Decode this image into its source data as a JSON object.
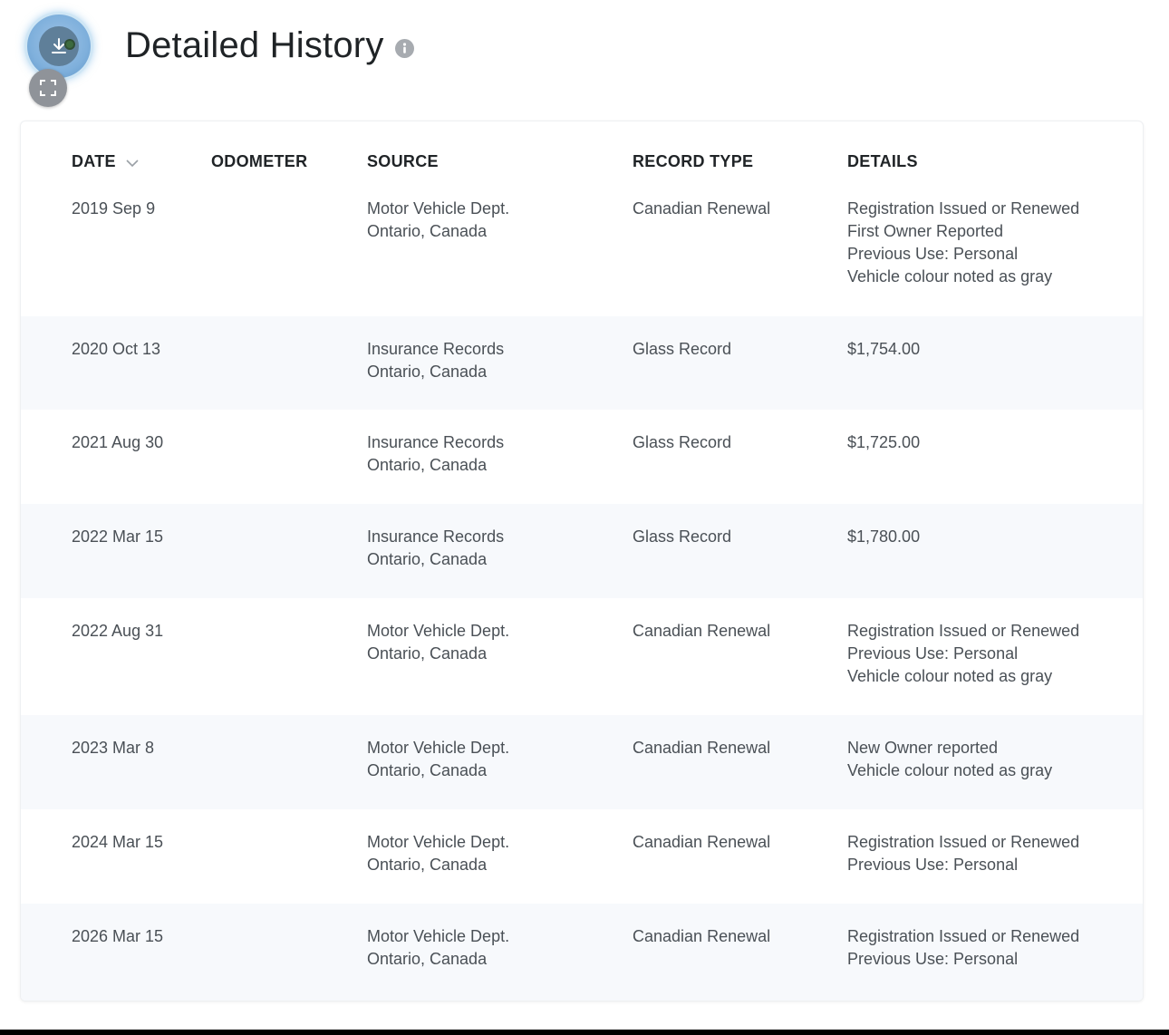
{
  "page": {
    "title": "Detailed History",
    "download_icon": "download-icon",
    "expand_icon": "fullscreen-icon",
    "info_icon": "info-icon"
  },
  "table": {
    "headers": {
      "date": "DATE",
      "odometer": "ODOMETER",
      "source": "SOURCE",
      "record_type": "RECORD TYPE",
      "details": "DETAILS"
    },
    "sort_icon": "chevron-down-icon",
    "rows": [
      {
        "date": "2019 Sep 9",
        "odometer": "",
        "source": [
          "Motor Vehicle Dept.",
          "Ontario, Canada"
        ],
        "record_type": "Canadian Renewal",
        "details": [
          "Registration Issued or Renewed",
          "First Owner Reported",
          "Previous Use: Personal",
          "Vehicle colour noted as gray"
        ]
      },
      {
        "date": "2020 Oct 13",
        "odometer": "",
        "source": [
          "Insurance Records",
          "Ontario, Canada"
        ],
        "record_type": "Glass Record",
        "details": [
          "$1,754.00"
        ]
      },
      {
        "date": "2021 Aug 30",
        "odometer": "",
        "source": [
          "Insurance Records",
          "Ontario, Canada"
        ],
        "record_type": "Glass Record",
        "details": [
          "$1,725.00"
        ]
      },
      {
        "date": "2022 Mar 15",
        "odometer": "",
        "source": [
          "Insurance Records",
          "Ontario, Canada"
        ],
        "record_type": "Glass Record",
        "details": [
          "$1,780.00"
        ]
      },
      {
        "date": "2022 Aug 31",
        "odometer": "",
        "source": [
          "Motor Vehicle Dept.",
          "Ontario, Canada"
        ],
        "record_type": "Canadian Renewal",
        "details": [
          "Registration Issued or Renewed",
          "Previous Use: Personal",
          "Vehicle colour noted as gray"
        ]
      },
      {
        "date": "2023 Mar 8",
        "odometer": "",
        "source": [
          "Motor Vehicle Dept.",
          "Ontario, Canada"
        ],
        "record_type": "Canadian Renewal",
        "details": [
          "New Owner reported",
          "Vehicle colour noted as gray"
        ]
      },
      {
        "date": "2024 Mar 15",
        "odometer": "",
        "source": [
          "Motor Vehicle Dept.",
          "Ontario, Canada"
        ],
        "record_type": "Canadian Renewal",
        "details": [
          "Registration Issued or Renewed",
          "Previous Use: Personal"
        ]
      },
      {
        "date": "2026 Mar 15",
        "odometer": "",
        "source": [
          "Motor Vehicle Dept.",
          "Ontario, Canada"
        ],
        "record_type": "Canadian Renewal",
        "details": [
          "Registration Issued or Renewed",
          "Previous Use: Personal"
        ]
      }
    ]
  },
  "colors": {
    "alt_row": "#f7f9fc",
    "text": "#4a5056",
    "heading": "#1f2326"
  }
}
